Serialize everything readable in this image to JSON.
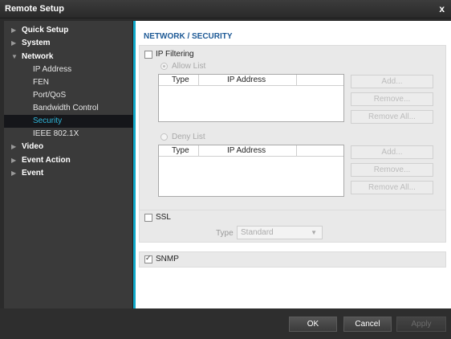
{
  "window": {
    "title": "Remote Setup",
    "close_glyph": "x"
  },
  "sidebar": {
    "items": [
      {
        "label": "Quick Setup",
        "arrow": "▶",
        "level": 0
      },
      {
        "label": "System",
        "arrow": "▶",
        "level": 0
      },
      {
        "label": "Network",
        "arrow": "▼",
        "level": 0
      },
      {
        "label": "IP Address",
        "level": 1
      },
      {
        "label": "FEN",
        "level": 1
      },
      {
        "label": "Port/QoS",
        "level": 1
      },
      {
        "label": "Bandwidth Control",
        "level": 1
      },
      {
        "label": "Security",
        "level": 1,
        "selected": true
      },
      {
        "label": "IEEE 802.1X",
        "level": 1
      },
      {
        "label": "Video",
        "arrow": "▶",
        "level": 0
      },
      {
        "label": "Event Action",
        "arrow": "▶",
        "level": 0
      },
      {
        "label": "Event",
        "arrow": "▶",
        "level": 0
      }
    ]
  },
  "content": {
    "section_title": "NETWORK / SECURITY",
    "ip_filtering": {
      "label": "IP Filtering",
      "checked": false,
      "allow_list": {
        "label": "Allow List",
        "selected": true,
        "columns": [
          "Type",
          "IP Address",
          ""
        ],
        "rows": [],
        "buttons": {
          "add": "Add...",
          "remove": "Remove...",
          "remove_all": "Remove All..."
        }
      },
      "deny_list": {
        "label": "Deny List",
        "selected": false,
        "columns": [
          "Type",
          "IP Address",
          ""
        ],
        "rows": [],
        "buttons": {
          "add": "Add...",
          "remove": "Remove...",
          "remove_all": "Remove All..."
        }
      }
    },
    "ssl": {
      "label": "SSL",
      "checked": false,
      "type_label": "Type",
      "type_value": "Standard"
    },
    "snmp": {
      "label": "SNMP",
      "checked": true
    }
  },
  "footer": {
    "ok": "OK",
    "cancel": "Cancel",
    "apply": "Apply"
  },
  "colors": {
    "accent": "#10a8c8",
    "selected_text": "#2fb6d9",
    "section_title": "#1e5a96"
  }
}
